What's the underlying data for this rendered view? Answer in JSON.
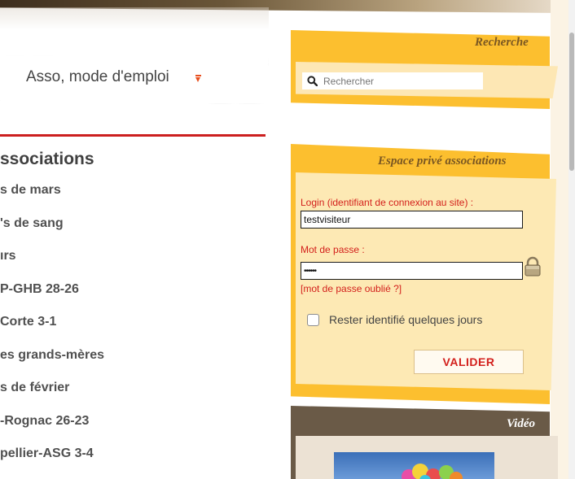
{
  "colors": {
    "accent_yellow": "#fcbf2f",
    "inner_yellow": "#fde9b4",
    "label_red": "#d3201c",
    "title_brown": "#7a5722",
    "video_bar": "#6a5a47",
    "rule_red": "#cc1f1f"
  },
  "menu": {
    "label": "Asso, mode d'emploi",
    "arrow_icon": "arrow-down-icon"
  },
  "associations": {
    "heading": "ssociations",
    "items": [
      "s de mars",
      "'s de sang",
      "ırs",
      "P-GHB 28-26",
      "Corte 3-1",
      "es grands-mères",
      "s de février",
      "-Rognac 26-23",
      "pellier-ASG 3-4"
    ]
  },
  "search": {
    "title": "Recherche",
    "placeholder": "Rechercher",
    "icon": "search-icon"
  },
  "private_space": {
    "title": "Espace privé associations",
    "login_label": "Login (identifiant de connexion au site) :",
    "login_value": "testvisiteur",
    "password_label": "Mot de passe :",
    "password_value": "••••••",
    "lock_icon": "lock-icon",
    "forgot_link": "[mot de passe oublié ?]",
    "remember_label": "Rester identifié quelques jours",
    "remember_checked": false,
    "submit_label": "VALIDER"
  },
  "video": {
    "title": "Vidéo"
  }
}
